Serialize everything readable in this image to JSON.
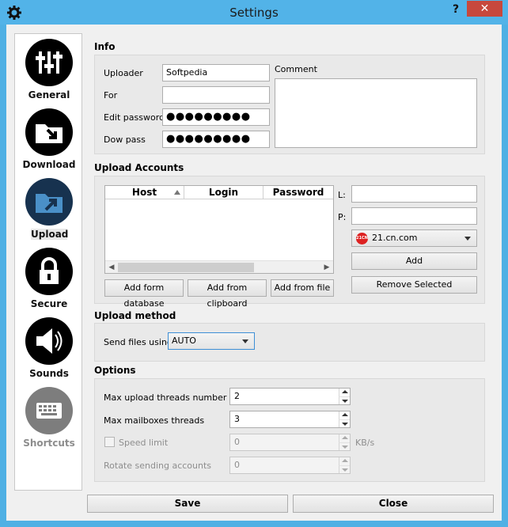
{
  "window": {
    "title": "Settings",
    "help": "?",
    "close": "✕"
  },
  "sidebar": {
    "items": [
      {
        "label": "General",
        "icon": "sliders-icon",
        "active": false,
        "enabled": true
      },
      {
        "label": "Download",
        "icon": "folder-download-icon",
        "active": false,
        "enabled": true
      },
      {
        "label": "Upload",
        "icon": "folder-upload-icon",
        "active": true,
        "enabled": true
      },
      {
        "label": "Secure",
        "icon": "lock-icon",
        "active": false,
        "enabled": true
      },
      {
        "label": "Sounds",
        "icon": "speaker-icon",
        "active": false,
        "enabled": true
      },
      {
        "label": "Shortcuts",
        "icon": "keyboard-icon",
        "active": false,
        "enabled": false
      }
    ]
  },
  "info": {
    "title": "Info",
    "uploader_label": "Uploader",
    "uploader_value": "Softpedia",
    "for_label": "For",
    "for_value": "",
    "edit_password_label": "Edit password",
    "edit_password_value": "●●●●●●●●●",
    "dow_pass_label": "Dow pass",
    "dow_pass_value": "●●●●●●●●●",
    "comment_label": "Comment",
    "comment_value": ""
  },
  "upload_accounts": {
    "title": "Upload Accounts",
    "columns": [
      "Host",
      "Login",
      "Password"
    ],
    "rows": [],
    "add_db_button": "Add form database",
    "add_clipboard_button": "Add from clipboard",
    "add_file_button": "Add from file",
    "login_label": "L:",
    "login_value": "",
    "password_label": "P:",
    "password_value": "",
    "site_selected": "21.cn.com",
    "site_icon_text": "21CN",
    "add_button": "Add",
    "remove_button": "Remove Selected"
  },
  "upload_method": {
    "title": "Upload method",
    "send_label": "Send files using",
    "send_value": "AUTO"
  },
  "options": {
    "title": "Options",
    "max_upload_label": "Max upload threads number",
    "max_upload_value": "2",
    "max_mailboxes_label": "Max mailboxes threads",
    "max_mailboxes_value": "3",
    "speed_limit_label": "Speed limit",
    "speed_limit_value": "0",
    "speed_unit": "KB/s",
    "rotate_label": "Rotate sending accounts",
    "rotate_value": "0"
  },
  "footer": {
    "save": "Save",
    "close": "Close"
  }
}
